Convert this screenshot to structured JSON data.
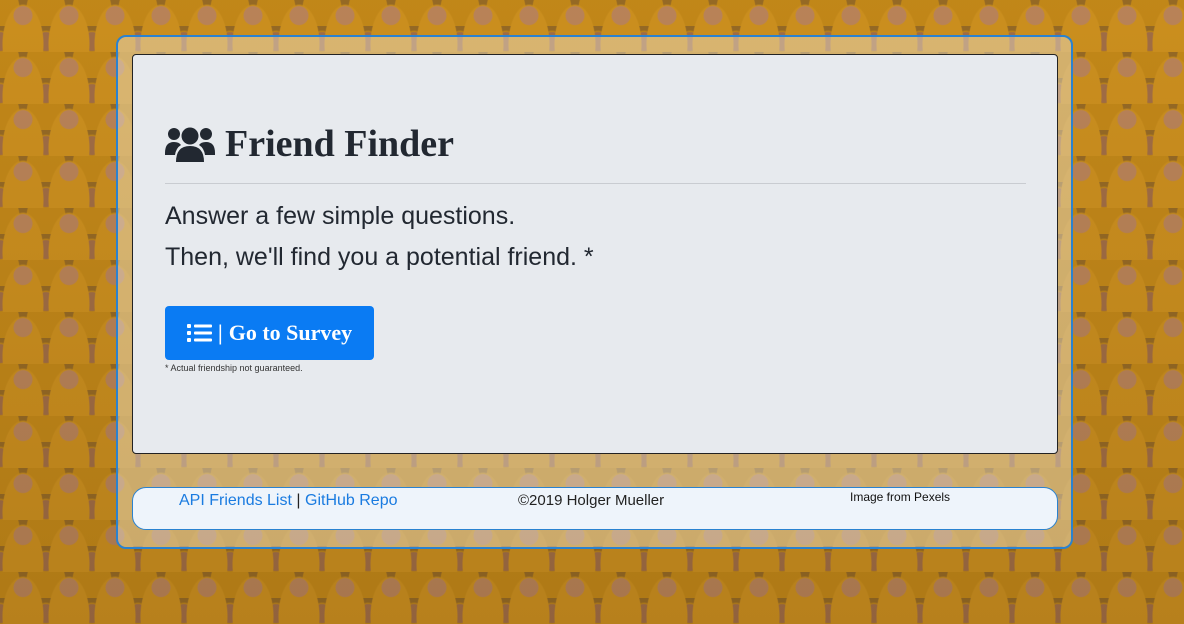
{
  "header": {
    "icon": "users-icon",
    "title": "Friend Finder"
  },
  "intro": {
    "line1": "Answer a few simple questions.",
    "line2": "Then, we'll find you a potential friend. *"
  },
  "survey_button": {
    "icon": "list-icon",
    "separator": "|",
    "label": "Go to Survey",
    "color": "#0a7bf3"
  },
  "disclaimer": "* Actual friendship not guaranteed.",
  "footer": {
    "api_link": "API Friends List",
    "separator": "|",
    "github_link": "GitHub Repo",
    "copyright": "©2019 Holger Mueller",
    "image_credit": "Image from Pexels"
  },
  "colors": {
    "accent": "#2a82d0",
    "link": "#1a7be0",
    "panel_bg": "#e7eaee"
  }
}
